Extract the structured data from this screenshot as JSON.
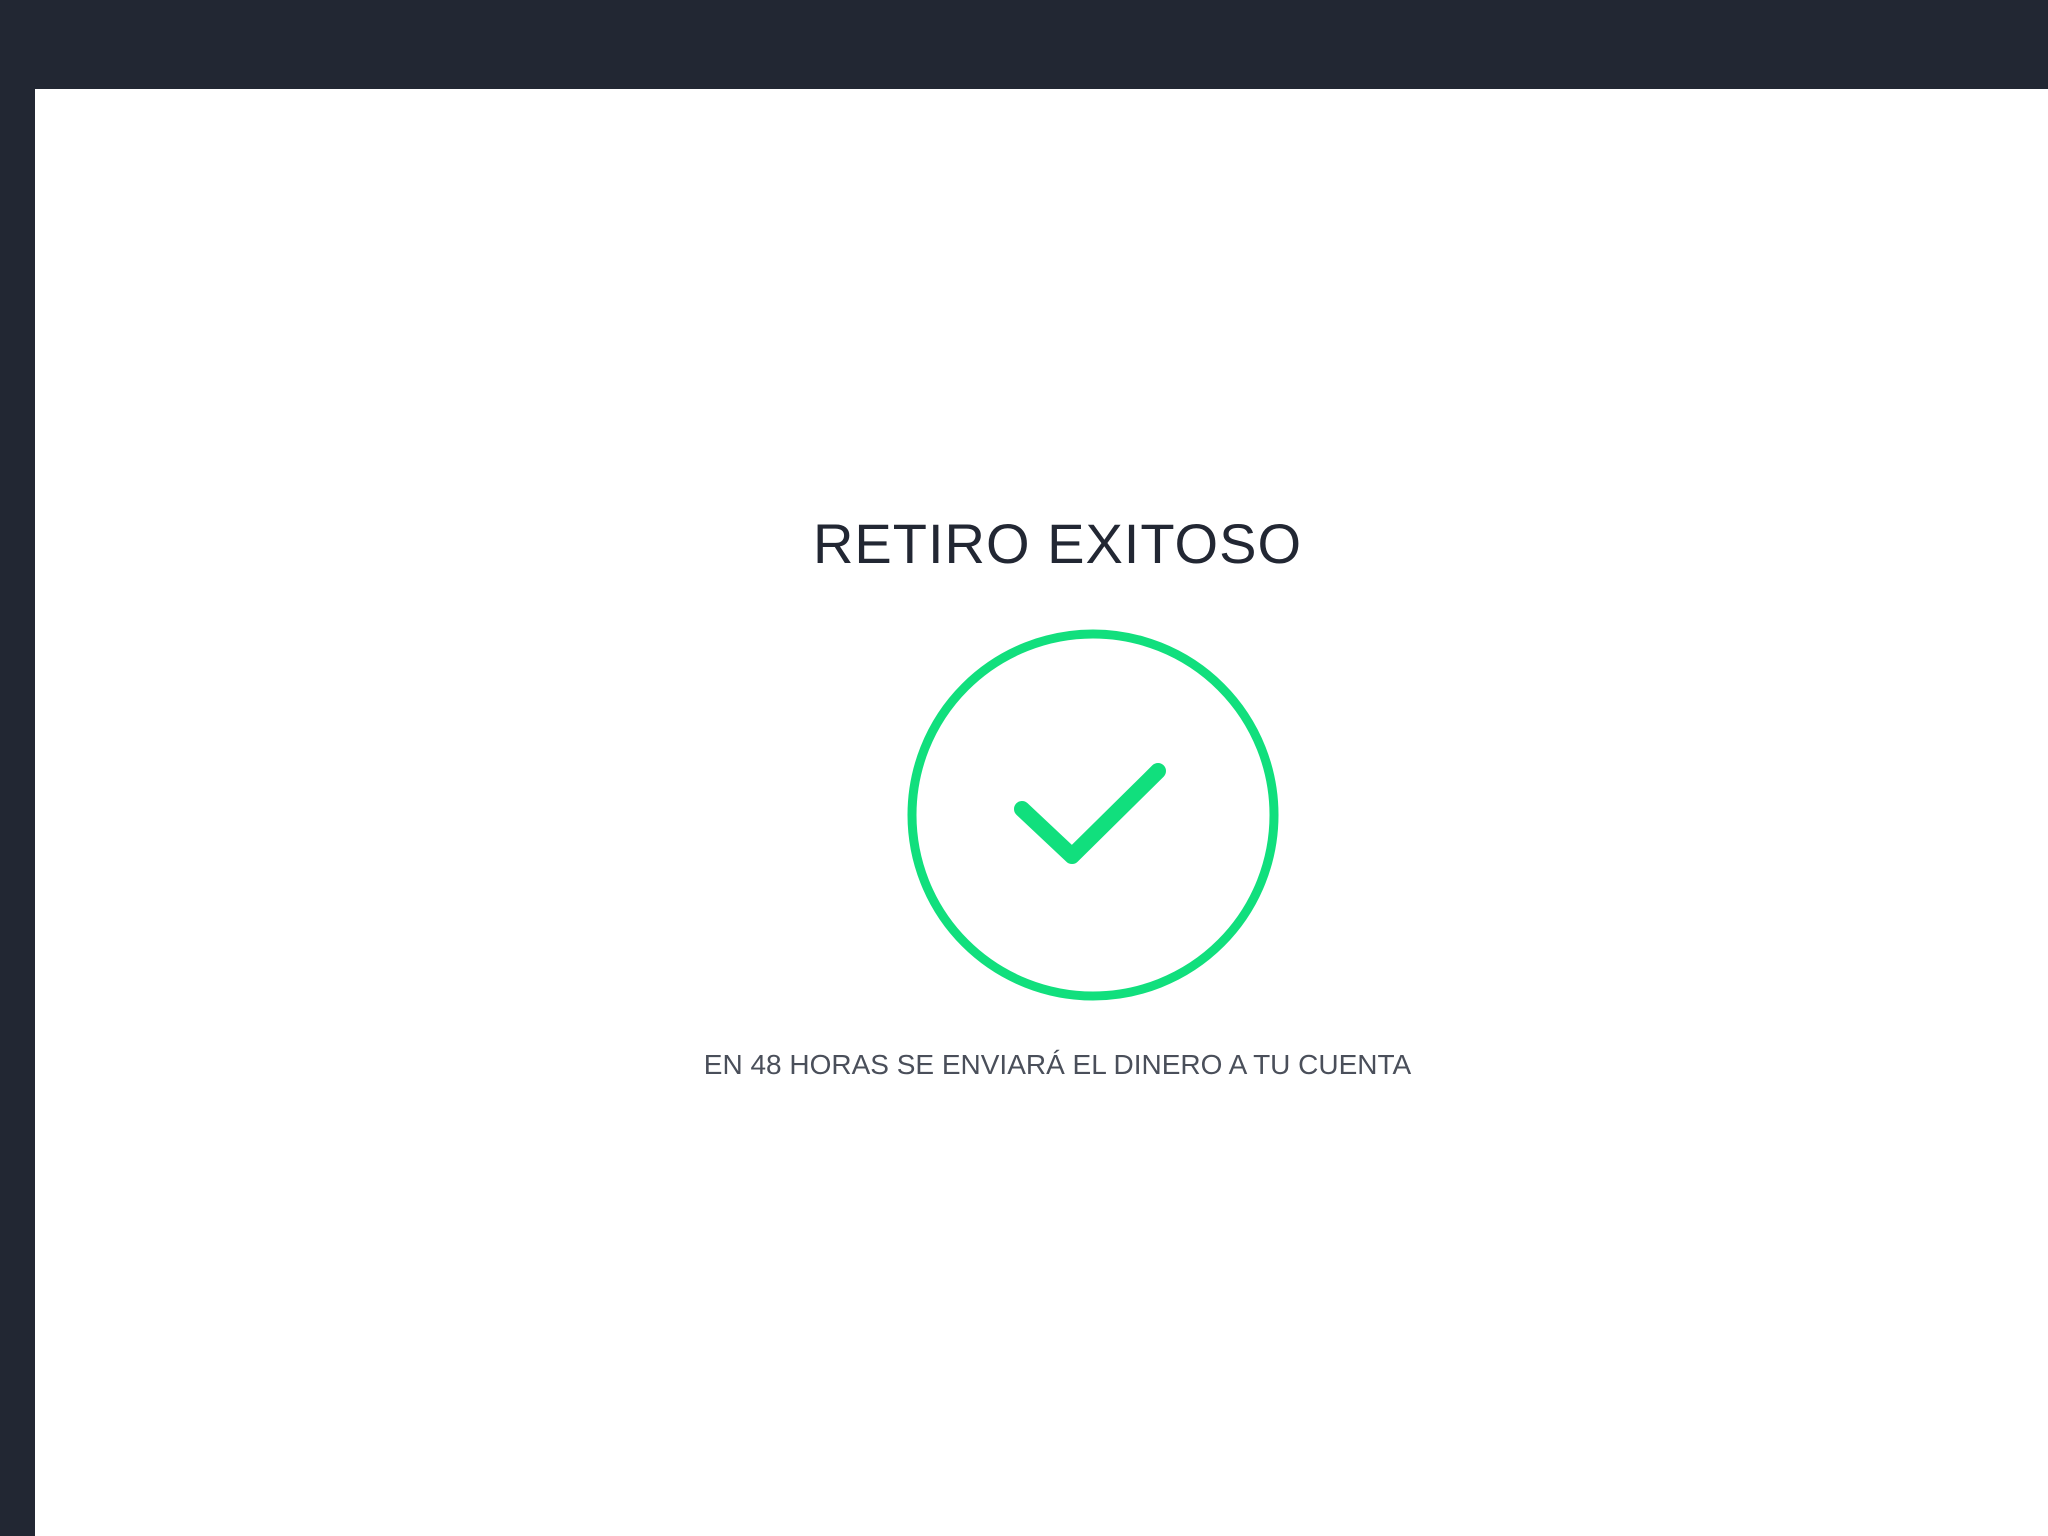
{
  "page": {
    "title": "RETIRO EXITOSO",
    "message": "EN 48 HORAS SE ENVIARÁ EL DINERO A TU CUENTA"
  },
  "icons": {
    "success": "check-circle-icon"
  },
  "colors": {
    "frame": "#222733",
    "background": "#ffffff",
    "success": "#11df7d",
    "title_text": "#222733",
    "message_text": "#4a4f5a"
  }
}
